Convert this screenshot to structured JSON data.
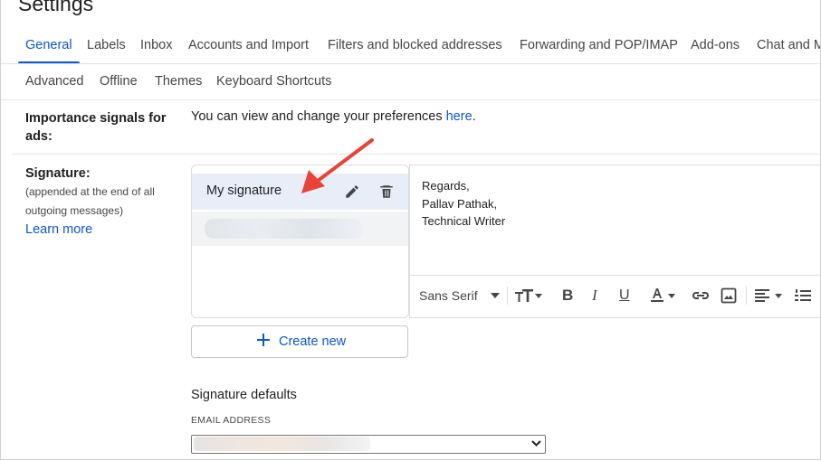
{
  "page": {
    "title": "Settings"
  },
  "tabs": [
    {
      "label": "General",
      "active": true
    },
    {
      "label": "Labels"
    },
    {
      "label": "Inbox"
    },
    {
      "label": "Accounts and Import"
    },
    {
      "label": "Filters and blocked addresses"
    },
    {
      "label": "Forwarding and POP/IMAP"
    },
    {
      "label": "Add-ons"
    },
    {
      "label": "Chat and M"
    },
    {
      "label": "Advanced"
    },
    {
      "label": "Offline"
    },
    {
      "label": "Themes"
    },
    {
      "label": "Keyboard Shortcuts"
    }
  ],
  "importance": {
    "label_line1": "Importance signals for",
    "label_line2": "ads:",
    "text": "You can view and change your preferences ",
    "link": "here",
    "trail": "."
  },
  "signature": {
    "label": "Signature:",
    "sub_line1": "(appended at the end of all",
    "sub_line2": "outgoing messages)",
    "learn_more": "Learn more",
    "items": [
      {
        "name": "My signature",
        "selected": true
      }
    ],
    "editor_lines": [
      "Regards,",
      "Pallav Pathak,",
      "Technical Writer"
    ],
    "toolbar": {
      "font": "Sans Serif",
      "icons": [
        "font-size-icon",
        "bold-icon",
        "italic-icon",
        "underline-icon",
        "text-color-icon",
        "link-icon",
        "image-icon",
        "align-icon",
        "numbered-list-icon"
      ]
    },
    "create_new": "Create new"
  },
  "defaults": {
    "title": "Signature defaults",
    "email_label": "EMAIL ADDRESS"
  },
  "colors": {
    "accent": "#0b57d0",
    "selected_bg": "#e8eef8",
    "annotation_arrow": "#ea4335"
  }
}
